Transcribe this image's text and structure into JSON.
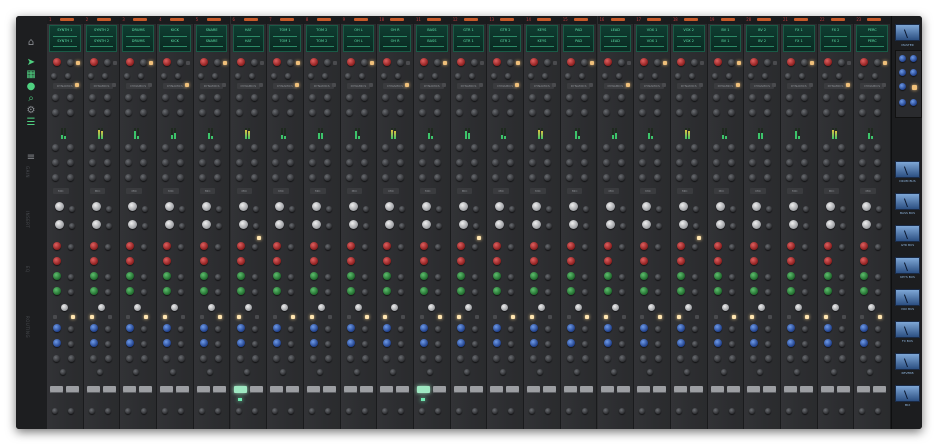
{
  "app": {
    "name": "Console Mixer"
  },
  "theme": {
    "accent": "#4fd080",
    "lcd": "#5fe0a8",
    "channel_bar": "#c75a2a"
  },
  "left_rail": {
    "icons": [
      "home-icon",
      "send-icon",
      "grid-icon",
      "mic-icon",
      "search-icon",
      "gear-icon",
      "layers-icon",
      "list-icon"
    ],
    "labels": [
      "GAIN",
      "INSERT",
      "EQ",
      "ROUTING"
    ]
  },
  "channels": [
    {
      "num": "1",
      "name": "SYNTH 1"
    },
    {
      "num": "2",
      "name": "SYNTH 2"
    },
    {
      "num": "3",
      "name": "DRUMS"
    },
    {
      "num": "4",
      "name": "KICK"
    },
    {
      "num": "5",
      "name": "SNARE"
    },
    {
      "num": "6",
      "name": "HAT"
    },
    {
      "num": "7",
      "name": "TOM 1"
    },
    {
      "num": "8",
      "name": "TOM 2"
    },
    {
      "num": "9",
      "name": "OH L"
    },
    {
      "num": "10",
      "name": "OH R"
    },
    {
      "num": "11",
      "name": "BASS"
    },
    {
      "num": "12",
      "name": "GTR 1"
    },
    {
      "num": "13",
      "name": "GTR 2"
    },
    {
      "num": "14",
      "name": "KEYS"
    },
    {
      "num": "15",
      "name": "PAD"
    },
    {
      "num": "16",
      "name": "LEAD"
    },
    {
      "num": "17",
      "name": "VOX 1"
    },
    {
      "num": "18",
      "name": "VOX 2"
    },
    {
      "num": "19",
      "name": "BV 1"
    },
    {
      "num": "20",
      "name": "BV 2"
    },
    {
      "num": "21",
      "name": "FX 1"
    },
    {
      "num": "22",
      "name": "FX 2"
    },
    {
      "num": "23",
      "name": "PERC"
    }
  ],
  "section_labels": {
    "dynamics": "DYNAMICS",
    "mic": "MIC",
    "line": "LINE",
    "eq": "EQ",
    "route": "ROUTE"
  },
  "right_panel": {
    "master_label": "MASTER",
    "tiles": [
      "DRUM BUS",
      "BASS BUS",
      "GTR BUS",
      "KEYS BUS",
      "VOX BUS",
      "FX BUS",
      "REVERB",
      "MIX"
    ]
  }
}
